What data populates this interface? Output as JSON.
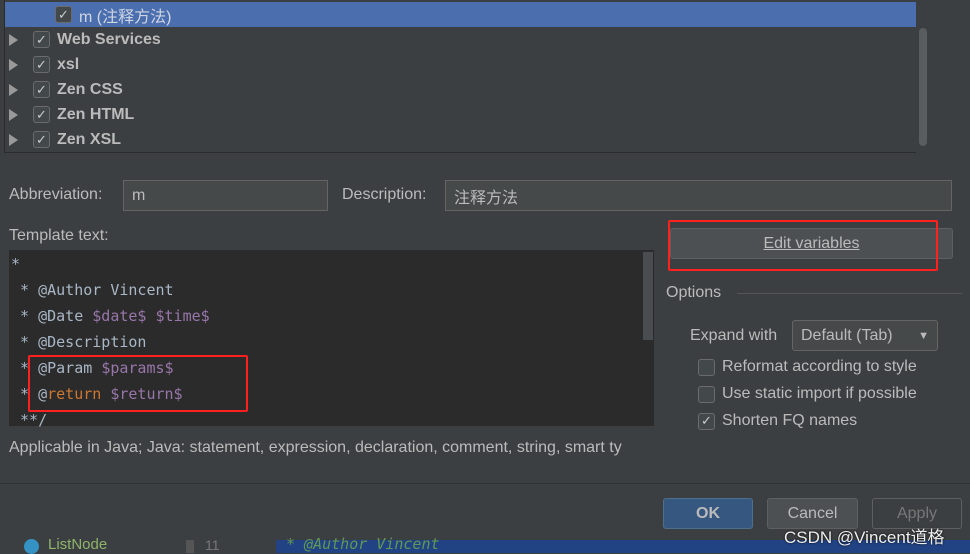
{
  "tree": {
    "selected_item": "m (注释方法)",
    "groups": [
      "Web Services",
      "xsl",
      "Zen CSS",
      "Zen HTML",
      "Zen XSL"
    ]
  },
  "form": {
    "abbreviation_label": "Abbreviation:",
    "abbreviation_value": "m",
    "description_label": "Description:",
    "description_value": "注释方法",
    "template_label": "Template text:"
  },
  "template_lines": [
    "*",
    " * @Author Vincent",
    " * @Date $date$ $time$",
    " * @Description",
    " * @Param $params$",
    " * @return $return$",
    " **/"
  ],
  "applicable": "Applicable in Java; Java: statement, expression, declaration, comment, string, smart ty",
  "edit_variables": "Edit variables",
  "options": {
    "title": "Options",
    "expand_label": "Expand with",
    "expand_value": "Default (Tab)",
    "reformat": "Reformat according to style",
    "static_import": "Use static import if possible",
    "shorten": "Shorten FQ names",
    "reformat_checked": false,
    "static_import_checked": false,
    "shorten_checked": true
  },
  "buttons": {
    "ok": "OK",
    "cancel": "Cancel",
    "apply": "Apply"
  },
  "background": {
    "class_name": "ListNode",
    "line_number": "11",
    "code": "* @Author Vincent"
  },
  "watermark": "CSDN @Vincent道格",
  "colors": {
    "selection": "#4b6eaf",
    "variable": "#9876aa",
    "keyword": "#cc7832",
    "highlight_box": "#ff2020"
  }
}
